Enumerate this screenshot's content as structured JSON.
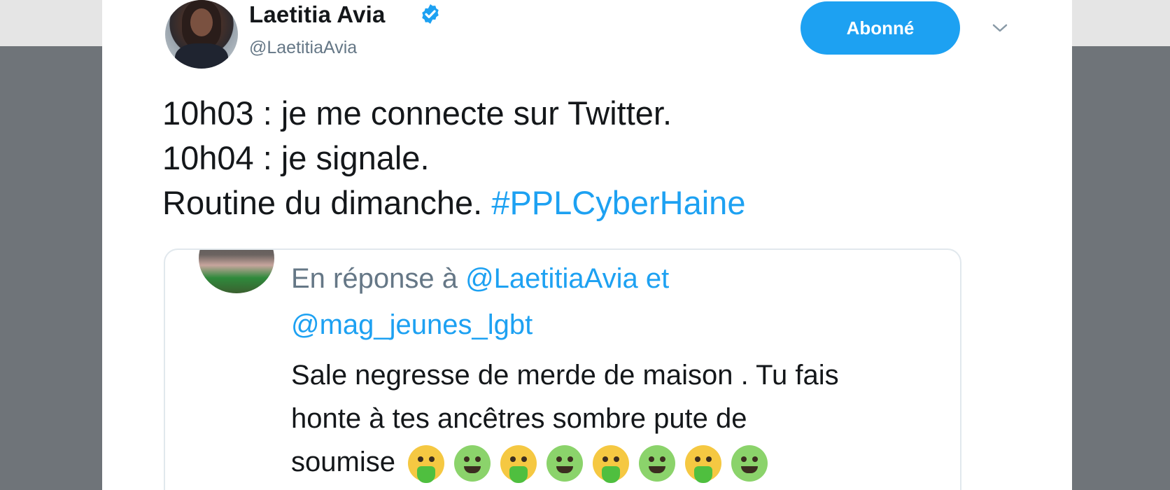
{
  "author": {
    "display_name": "Laetitia Avia",
    "handle": "@LaetitiaAvia",
    "verified": true
  },
  "actions": {
    "follow_label": "Abonné"
  },
  "tweet": {
    "lines": [
      "10h03 : je me connecte sur Twitter.",
      "10h04 : je signale.",
      "Routine du dimanche."
    ],
    "hashtag": "#PPLCyberHaine"
  },
  "quoted_tweet": {
    "reply_prefix": "En réponse à",
    "mention_1": "@LaetitiaAvia",
    "conjunction": "et",
    "mention_2": "@mag_jeunes_lgbt",
    "text_lines": [
      "Sale negresse de merde de maison . Tu fais",
      "honte à tes ancêtres sombre pute de",
      "soumise"
    ],
    "emojis": [
      "vomiting-face-icon",
      "nauseated-face-icon",
      "vomiting-face-icon",
      "nauseated-face-icon",
      "vomiting-face-icon",
      "nauseated-face-icon",
      "vomiting-face-icon",
      "nauseated-face-icon"
    ]
  },
  "colors": {
    "accent": "#1da1f2",
    "text": "#14171a",
    "muted": "#657786",
    "border": "#e1e8ed"
  }
}
